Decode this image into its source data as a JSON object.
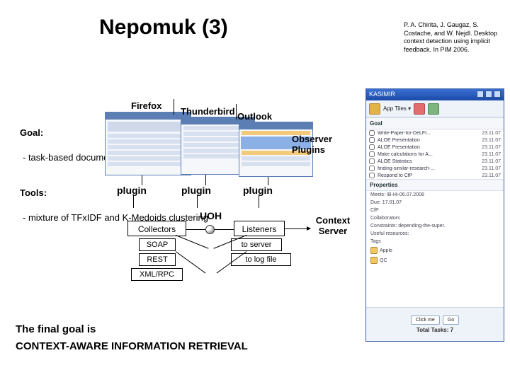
{
  "title": "Nepomuk (3)",
  "citation": "P. A. Chirita, J. Gaugaz, S. Costache, and W. Nejdl. Desktop context detection using implicit feedback. In PIM 2006.",
  "left": {
    "goal_label": "Goal:",
    "task_based": "- task-based document clustering",
    "tools_label": "Tools:",
    "mixture": "- mixture of TFxIDF and K-Medoids clustering"
  },
  "apps": {
    "firefox": "Firefox",
    "thunderbird": "Thunderbird",
    "outlook": "Outlook"
  },
  "observer": "Observer Plugins",
  "plugin_label": "plugin",
  "uoh": {
    "label": "UOH",
    "collectors": "Collectors",
    "listeners": "Listeners",
    "soap": "SOAP",
    "rest": "REST",
    "xmlrpc": "XML/RPC",
    "to_server": "to server",
    "to_log": "to log file"
  },
  "context_server": "Context Server",
  "final": {
    "line1": "The final goal is",
    "line2": "CONTEXT-AWARE INFORMATION RETRIEVAL"
  },
  "kasimir": {
    "title": "KASIMIR",
    "section_goal": "Goal",
    "items": [
      {
        "label": "Write-Paper-for-DeLFI...",
        "date": "23.11.07"
      },
      {
        "label": "ALOE Presentation",
        "date": "23.11.07"
      },
      {
        "label": "ALOE Presentation",
        "date": "23.11.07"
      },
      {
        "label": "Make calculations for A...",
        "date": "23.11.07"
      },
      {
        "label": "ALOE Statistics",
        "date": "23.11.07"
      },
      {
        "label": "finding-similar-research-...",
        "date": "23.11.07"
      },
      {
        "label": "Respond to CfP",
        "date": "23.11.07"
      }
    ],
    "props_title": "Properties",
    "props": [
      "Meets: IB-Hi-06.07.2008",
      "Due: 17.01.07",
      "CfP",
      "Collaborators",
      "Constraints: depending-the-super.",
      "Useful resources:",
      "Tags"
    ],
    "tags": [
      "Apple",
      "QC"
    ],
    "btn_click": "Click me",
    "btn_go": "Go",
    "total": "Total Tasks: 7"
  }
}
